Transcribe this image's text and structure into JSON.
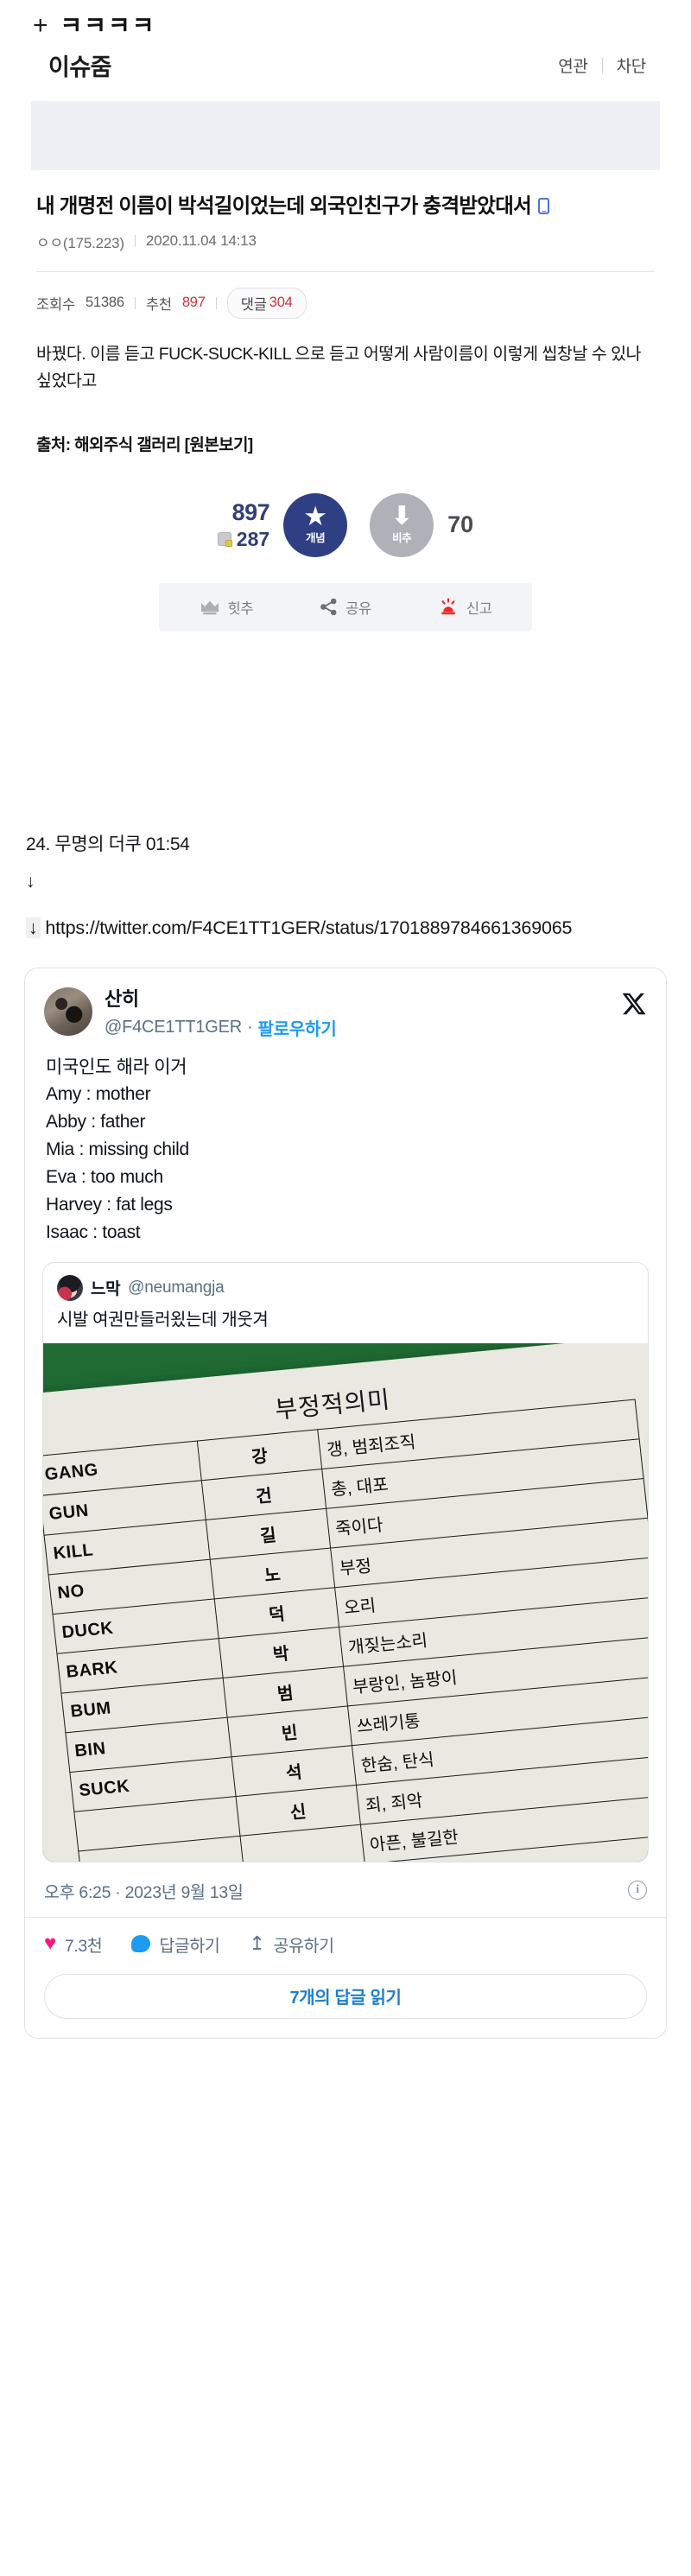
{
  "topstrip": {
    "plus_icon": "plus-icon",
    "text": "ㅋㅋㅋㅋ"
  },
  "header": {
    "site_title": "이슈줌",
    "actions": [
      {
        "label": "연관"
      },
      {
        "label": "차단"
      }
    ]
  },
  "post": {
    "title": "내 개명전 이름이 박석길이었는데 외국인친구가 충격받았대서",
    "mobile_badge_icon": "mobile-device-icon",
    "author": "ㅇㅇ(175.223)",
    "date": "2020.11.04 14:13",
    "stats": {
      "views_label": "조회수",
      "views_value": "51386",
      "recommend_label": "추천",
      "recommend_value": "897",
      "comments_label": "댓글",
      "comments_value": "304"
    },
    "body": "바꿨다. 이름 듣고 FUCK-SUCK-KILL 으로 듣고 어떻게 사람이름이 이렇게 씹창날 수 있나 싶었다고",
    "source": "출처: 해외주식 갤러리 [원본보기]"
  },
  "vote": {
    "up_count": "897",
    "sub_count": "287",
    "up_label": "개념",
    "down_label": "비추",
    "down_count": "70",
    "up_color": "#2f3f84",
    "down_color": "#b0b0b8",
    "count_color": "#323f77"
  },
  "actions": [
    {
      "label": "힛추",
      "icon": "crown-icon"
    },
    {
      "label": "공유",
      "icon": "share-icon"
    },
    {
      "label": "신고",
      "icon": "siren-icon"
    }
  ],
  "comment": {
    "header": "24. 무명의 더쿠 01:54",
    "arrow": "↓",
    "link_arrow": "↓",
    "link": "https://twitter.com/F4CE1TT1GER/status/1701889784661369065"
  },
  "tweet": {
    "avatar_icon": "avatar",
    "name": "산히",
    "handle": "@F4CE1TT1GER",
    "separator": "·",
    "follow_label": "팔로우하기",
    "brand_icon": "x-logo-icon",
    "lines": [
      "미국인도 해라 이거",
      "Amy : mother",
      "Abby : father",
      "Mia : missing child",
      "Eva : too much",
      "Harvey : fat legs",
      "Isaac : toast"
    ],
    "timestamp": "오후 6:25 · 2023년 9월 13일",
    "info_icon": "info-icon",
    "engagement": [
      {
        "icon": "heart-icon",
        "label": "7.3천"
      },
      {
        "icon": "reply-bubble-icon",
        "label": "답글하기"
      },
      {
        "icon": "share-up-icon",
        "label": "공유하기"
      }
    ],
    "read_replies_label": "7개의 답글 읽기"
  },
  "quoted_tweet": {
    "avatar_icon": "avatar",
    "name": "느막",
    "handle": "@neumangja",
    "text": "시발 여권만들러욌는데 개웃겨",
    "photo": {
      "background_color": "#1f6b33",
      "paper_color": "#e9e8e1",
      "table": {
        "title": "부정적의미",
        "columns": [
          "english",
          "korean",
          "meaning"
        ],
        "rows": [
          {
            "english": "GANG",
            "korean": "강",
            "meaning": "갱, 범죄조직"
          },
          {
            "english": "GUN",
            "korean": "건",
            "meaning": "총, 대포"
          },
          {
            "english": "KILL",
            "korean": "길",
            "meaning": "죽이다"
          },
          {
            "english": "NO",
            "korean": "노",
            "meaning": "부정"
          },
          {
            "english": "DUCK",
            "korean": "덕",
            "meaning": "오리"
          },
          {
            "english": "BARK",
            "korean": "박",
            "meaning": "개짖는소리"
          },
          {
            "english": "BUM",
            "korean": "범",
            "meaning": "부랑인, 놈팡이"
          },
          {
            "english": "BIN",
            "korean": "빈",
            "meaning": "쓰레기통"
          },
          {
            "english": "SUCK",
            "korean": "석",
            "meaning": "한숨, 탄식"
          },
          {
            "english": "",
            "korean": "신",
            "meaning": "죄, 죄악"
          },
          {
            "english": "",
            "korean": "",
            "meaning": "아픈, 불길한"
          }
        ]
      }
    }
  }
}
